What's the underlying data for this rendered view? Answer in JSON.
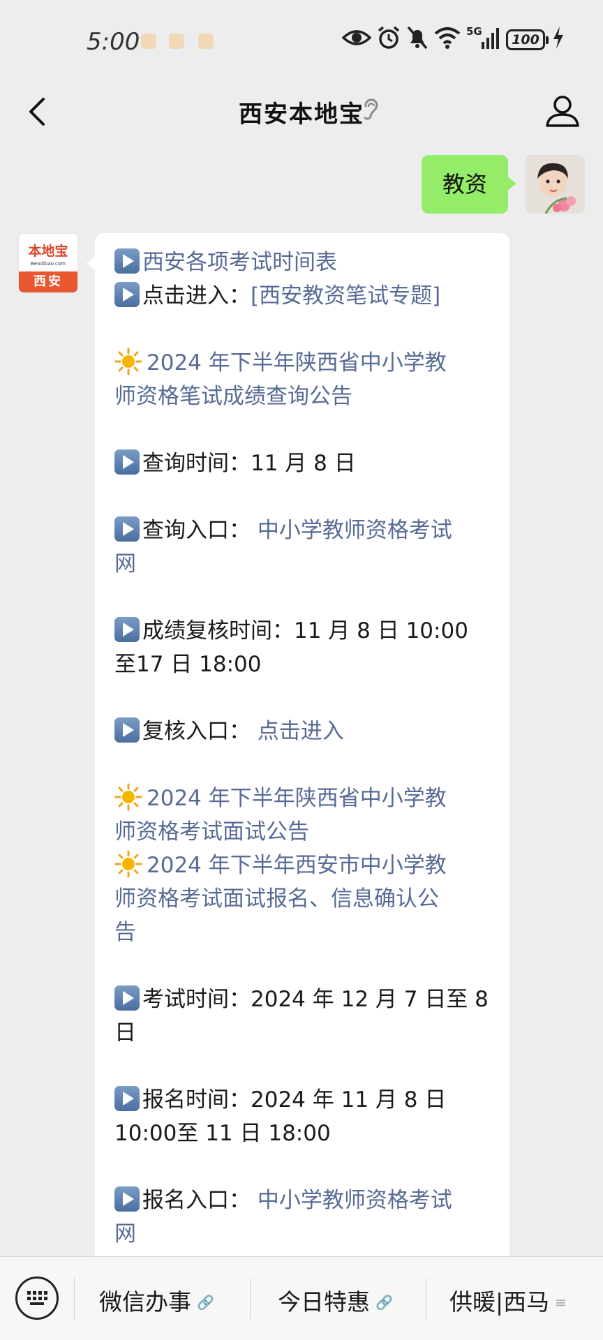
{
  "status_bar": {
    "time": "5:00",
    "network": "5G",
    "battery": "100"
  },
  "header": {
    "title": "西安本地宝"
  },
  "chat": {
    "user_message": "教资",
    "bot_avatar": {
      "brand": "本地宝",
      "domain": "Bendibao.com",
      "city": "西安"
    },
    "bot_message": {
      "l1": "西安各项考试时间表",
      "l2_prefix": "点击进入：",
      "l2_link": "[西安教资笔试专题]",
      "a1_text": "2024 年下半年陕西省中小学教",
      "a1_text2": "师资格笔试成绩查询公告",
      "q_time_label": "查询时间：",
      "q_time_value": "11 月 8 日",
      "q_entry_label": "查询入口：",
      "q_entry_link": "中小学教师资格考试",
      "q_entry_link2": "网",
      "r_time_label": "成绩复核时间：",
      "r_time_value": "11 月 8 日 10:00",
      "r_time_value2": "至17 日 18:00",
      "r_entry_label": "复核入口：",
      "r_entry_link": "点击进入",
      "a2_text": "2024 年下半年陕西省中小学教",
      "a2_text2": "师资格考试面试公告",
      "a3_text": "2024 年下半年西安市中小学教",
      "a3_text2": "师资格考试面试报名、信息确认公",
      "a3_text3": "告",
      "e_time_label": "考试时间：",
      "e_time_value": "2024 年 12 月 7 日至 8",
      "e_time_value2": "日",
      "s_time_label": "报名时间：",
      "s_time_value": "2024 年 11 月 8 日",
      "s_time_value2": "10:00至 11 日 18:00",
      "s_entry_label": "报名入口：",
      "s_entry_link": "中小学教师资格考试",
      "s_entry_link2": "网"
    }
  },
  "bottom_menu": {
    "items": [
      "微信办事",
      "今日特惠",
      "供暖|西马"
    ]
  }
}
